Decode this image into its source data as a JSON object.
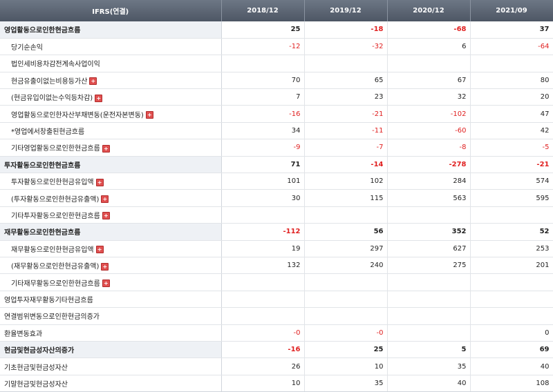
{
  "header": {
    "label": "IFRS(연결)",
    "periods": [
      "2018/12",
      "2019/12",
      "2020/12",
      "2021/09"
    ]
  },
  "colors": {
    "negative": "#e02020",
    "header_bg": "#5b6472",
    "main_row_bg": "#eef1f5"
  },
  "rows": [
    {
      "label": "영업활동으로인한현금흐름",
      "kind": "main",
      "expand": false,
      "values": [
        "25",
        "-18",
        "-68",
        "37"
      ]
    },
    {
      "label": "당기순손익",
      "kind": "sub",
      "expand": false,
      "values": [
        "-12",
        "-32",
        "6",
        "-64"
      ]
    },
    {
      "label": "법인세비용차감전계속사업이익",
      "kind": "sub",
      "expand": false,
      "values": [
        "",
        "",
        "",
        ""
      ]
    },
    {
      "label": "현금유출이없는비용등가산",
      "kind": "sub",
      "expand": true,
      "values": [
        "70",
        "65",
        "67",
        "80"
      ]
    },
    {
      "label": "(현금유입이없는수익등차감)",
      "kind": "sub",
      "expand": true,
      "values": [
        "7",
        "23",
        "32",
        "20"
      ]
    },
    {
      "label": "영업활동으로인한자산부채변동(운전자본변동)",
      "kind": "sub",
      "expand": true,
      "values": [
        "-16",
        "-21",
        "-102",
        "47"
      ]
    },
    {
      "label": "*영업에서창출된현금흐름",
      "kind": "sub",
      "expand": false,
      "values": [
        "34",
        "-11",
        "-60",
        "42"
      ]
    },
    {
      "label": "기타영업활동으로인한현금흐름",
      "kind": "sub",
      "expand": true,
      "values": [
        "-9",
        "-7",
        "-8",
        "-5"
      ]
    },
    {
      "label": "투자활동으로인한현금흐름",
      "kind": "main",
      "expand": false,
      "values": [
        "71",
        "-14",
        "-278",
        "-21"
      ]
    },
    {
      "label": "투자활동으로인한현금유입액",
      "kind": "sub",
      "expand": true,
      "values": [
        "101",
        "102",
        "284",
        "574"
      ]
    },
    {
      "label": "(투자활동으로인한현금유출액)",
      "kind": "sub",
      "expand": true,
      "values": [
        "30",
        "115",
        "563",
        "595"
      ]
    },
    {
      "label": "기타투자활동으로인한현금흐름",
      "kind": "sub",
      "expand": true,
      "values": [
        "",
        "",
        "",
        ""
      ]
    },
    {
      "label": "재무활동으로인한현금흐름",
      "kind": "main",
      "expand": false,
      "values": [
        "-112",
        "56",
        "352",
        "52"
      ]
    },
    {
      "label": "재무활동으로인한현금유입액",
      "kind": "sub",
      "expand": true,
      "values": [
        "19",
        "297",
        "627",
        "253"
      ]
    },
    {
      "label": "(재무활동으로인한현금유출액)",
      "kind": "sub",
      "expand": true,
      "values": [
        "132",
        "240",
        "275",
        "201"
      ]
    },
    {
      "label": "기타재무활동으로인한현금흐름",
      "kind": "sub",
      "expand": true,
      "values": [
        "",
        "",
        "",
        ""
      ]
    },
    {
      "label": "영업투자재무활동기타현금흐름",
      "kind": "plain",
      "expand": false,
      "values": [
        "",
        "",
        "",
        ""
      ]
    },
    {
      "label": "연결범위변동으로인한현금의증가",
      "kind": "plain",
      "expand": false,
      "values": [
        "",
        "",
        "",
        ""
      ]
    },
    {
      "label": "환율변동효과",
      "kind": "plain",
      "expand": false,
      "values": [
        "-0",
        "-0",
        "",
        "0"
      ]
    },
    {
      "label": "현금및현금성자산의증가",
      "kind": "main",
      "expand": false,
      "values": [
        "-16",
        "25",
        "5",
        "69"
      ]
    },
    {
      "label": "기초현금및현금성자산",
      "kind": "plain",
      "expand": false,
      "values": [
        "26",
        "10",
        "35",
        "40"
      ]
    },
    {
      "label": "기말현금및현금성자산",
      "kind": "plain",
      "expand": false,
      "values": [
        "10",
        "35",
        "40",
        "108"
      ]
    }
  ]
}
